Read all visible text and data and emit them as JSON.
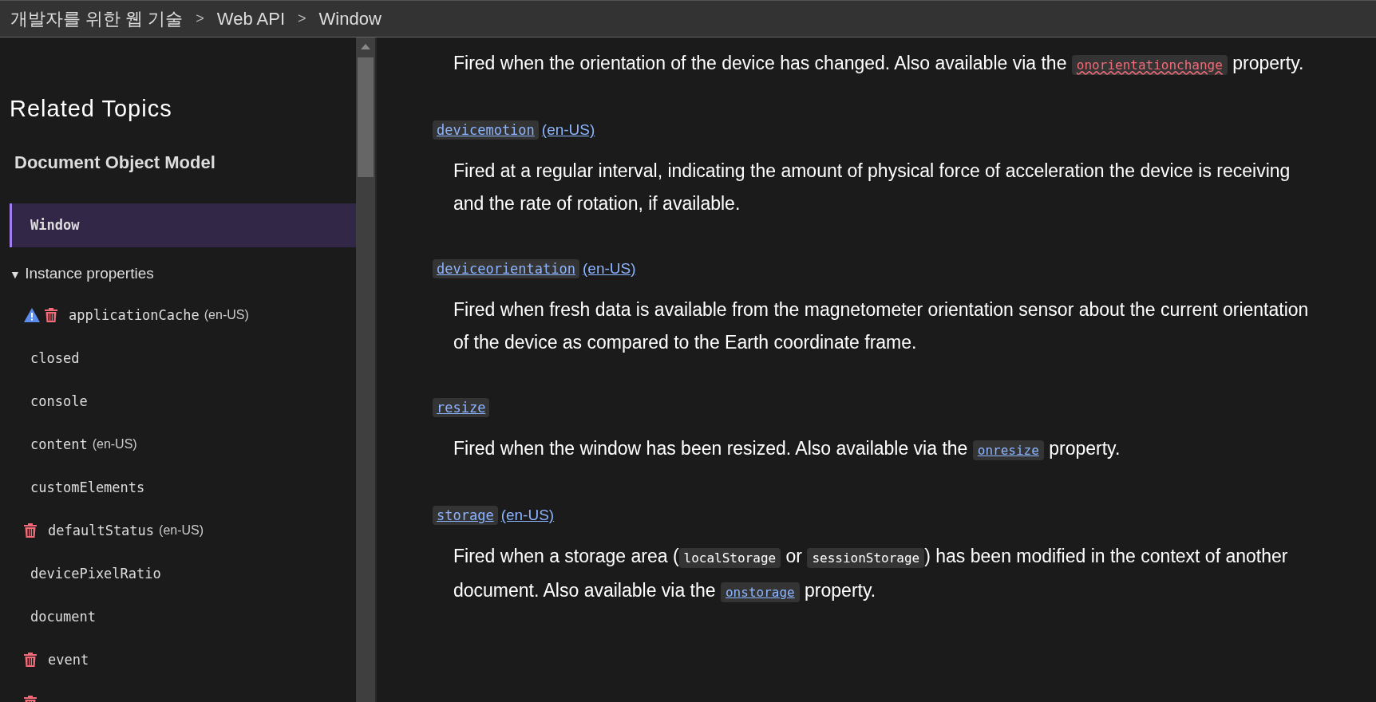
{
  "breadcrumbs": [
    {
      "label": "개발자를 위한 웹 기술"
    },
    {
      "label": "Web API"
    },
    {
      "label": "Window"
    }
  ],
  "breadcrumb_separator": ">",
  "sidebar": {
    "title": "Related Topics",
    "section": "Document Object Model",
    "current": {
      "label": "Window",
      "selected": true
    },
    "group": {
      "label": "Instance properties",
      "expanded": true,
      "toggle": "▼",
      "items": [
        {
          "name": "applicationCache",
          "locale": "(en-US)",
          "experimental": true,
          "deprecated": true
        },
        {
          "name": "closed",
          "experimental": false,
          "deprecated": false
        },
        {
          "name": "console",
          "experimental": false,
          "deprecated": false
        },
        {
          "name": "content",
          "locale": "(en-US)",
          "experimental": false,
          "deprecated": false
        },
        {
          "name": "customElements",
          "experimental": false,
          "deprecated": false
        },
        {
          "name": "defaultStatus",
          "locale": "(en-US)",
          "experimental": false,
          "deprecated": true
        },
        {
          "name": "devicePixelRatio",
          "experimental": false,
          "deprecated": false
        },
        {
          "name": "document",
          "experimental": false,
          "deprecated": false
        },
        {
          "name": "event",
          "experimental": false,
          "deprecated": true
        },
        {
          "experimental": false,
          "deprecated": true
        }
      ]
    }
  },
  "events": [
    {
      "description": [
        {
          "kind": "text",
          "text": "Fired when the orientation of the device has changed. Also available via the "
        },
        {
          "kind": "missing-link",
          "text": "onorientationchange"
        },
        {
          "kind": "text",
          "text": " property."
        }
      ]
    },
    {
      "term": "devicemotion",
      "locale": "(en-US)",
      "description": [
        {
          "kind": "text",
          "text": "Fired at a regular interval, indicating the amount of physical force of acceleration the device is receiving and the rate of rotation, if available."
        }
      ]
    },
    {
      "term": "deviceorientation",
      "locale": "(en-US)",
      "description": [
        {
          "kind": "text",
          "text": "Fired when fresh data is available from the magnetometer orientation sensor about the current orientation of the device as compared to the Earth coordinate frame."
        }
      ]
    },
    {
      "term": "resize",
      "description": [
        {
          "kind": "text",
          "text": "Fired when the window has been resized. Also available via the "
        },
        {
          "kind": "link",
          "text": "onresize"
        },
        {
          "kind": "text",
          "text": " property."
        }
      ]
    },
    {
      "term": "storage",
      "locale": "(en-US)",
      "description": [
        {
          "kind": "text",
          "text": "Fired when a storage area ("
        },
        {
          "kind": "code",
          "text": "localStorage"
        },
        {
          "kind": "text",
          "text": " or "
        },
        {
          "kind": "code",
          "text": "sessionStorage"
        },
        {
          "kind": "text",
          "text": ") has been modified in the context of another document. Also available via the "
        },
        {
          "kind": "link",
          "text": "onstorage"
        },
        {
          "kind": "text",
          "text": " property."
        }
      ]
    }
  ]
}
